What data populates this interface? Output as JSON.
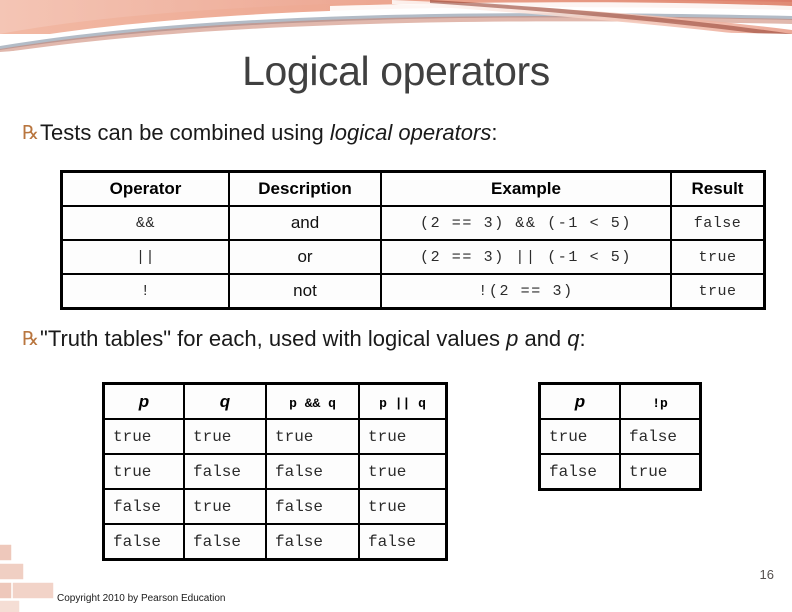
{
  "slide": {
    "title": "Logical operators",
    "page_number": "16",
    "copyright": "Copyright 2010 by Pearson Education",
    "bullet_glyph": "℞",
    "accent_color": "#b9763f",
    "title_color": "#404040",
    "header_band_colors": [
      "#f6cdbf",
      "#e8907c",
      "#d9705e",
      "#f3b9a6"
    ],
    "brick_color": "#eec8bb"
  },
  "bullets": [
    {
      "id": "bullet-tests-combined",
      "parts": [
        {
          "text": "Tests can be combined using ",
          "italic": false
        },
        {
          "text": "logical operators",
          "italic": true
        },
        {
          "text": ":",
          "italic": false
        }
      ]
    },
    {
      "id": "bullet-truth-tables",
      "parts": [
        {
          "text": "\"Truth tables\" for each, used with logical values ",
          "italic": false
        },
        {
          "text": "p",
          "italic": true
        },
        {
          "text": " and ",
          "italic": false
        },
        {
          "text": "q",
          "italic": true
        },
        {
          "text": ":",
          "italic": false
        }
      ]
    }
  ],
  "operator_table": {
    "headers": [
      "Operator",
      "Description",
      "Example",
      "Result"
    ],
    "rows": [
      {
        "operator": "&&",
        "description": "and",
        "example": "(2 == 3) && (-1 < 5)",
        "result": "false"
      },
      {
        "operator": "||",
        "description": "or",
        "example": "(2 == 3) || (-1 < 5)",
        "result": "true"
      },
      {
        "operator": "!",
        "description": "not",
        "example": "!(2 == 3)",
        "result": "true"
      }
    ]
  },
  "truth_table_pq": {
    "headers": [
      "p",
      "q",
      "p && q",
      "p || q"
    ],
    "rows": [
      [
        "true",
        "true",
        "true",
        "true"
      ],
      [
        "true",
        "false",
        "false",
        "true"
      ],
      [
        "false",
        "true",
        "false",
        "true"
      ],
      [
        "false",
        "false",
        "false",
        "false"
      ]
    ]
  },
  "truth_table_not": {
    "headers": [
      "p",
      "!p"
    ],
    "rows": [
      [
        "true",
        "false"
      ],
      [
        "false",
        "true"
      ]
    ]
  }
}
